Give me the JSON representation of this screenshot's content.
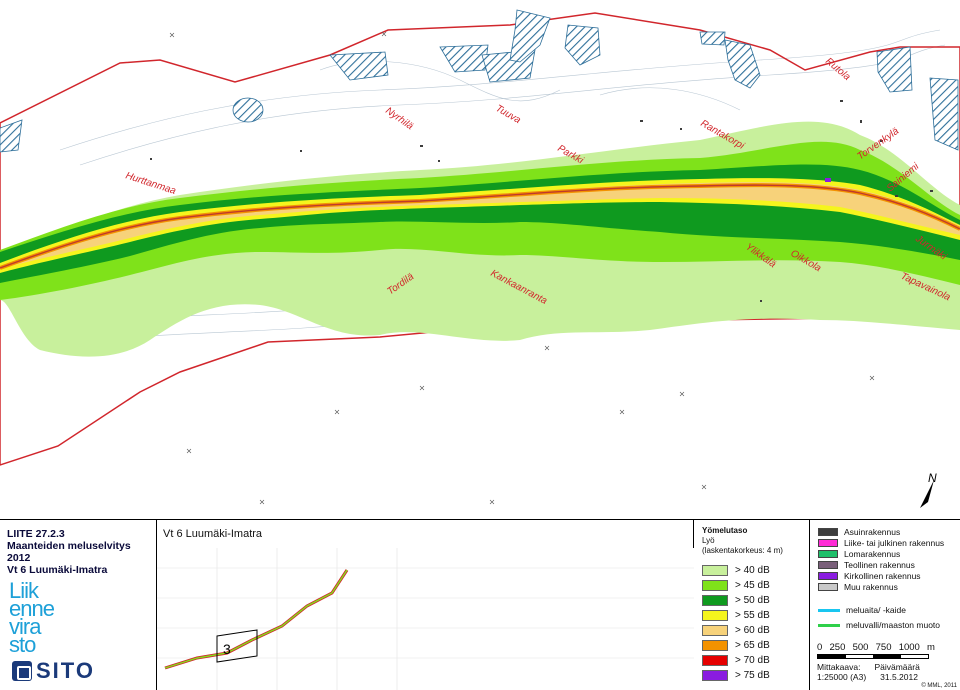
{
  "map": {
    "places": [
      {
        "name": "Hurttanmaa"
      },
      {
        "name": "Nyrhilä"
      },
      {
        "name": "Tuuva"
      },
      {
        "name": "Parkki"
      },
      {
        "name": "Rantakorpi"
      },
      {
        "name": "Rutola"
      },
      {
        "name": "Torvenkylä"
      },
      {
        "name": "Sainiemi"
      },
      {
        "name": "Jurmäki"
      },
      {
        "name": "Tapavainola"
      },
      {
        "name": "Oikkola"
      },
      {
        "name": "Ylikkälä"
      },
      {
        "name": "Kankaanranta"
      },
      {
        "name": "Tordilä"
      }
    ],
    "north_label": "N"
  },
  "title_block": {
    "appendix": "LIITE 27.2.3",
    "line1": "Maanteiden meluselvitys 2012",
    "line2": "Vt 6 Luumäki-Imatra",
    "logo_words": [
      "Liik",
      "enne",
      "vira",
      "sto"
    ],
    "sito": "SITO"
  },
  "overview": {
    "title": "Vt 6 Luumäki-Imatra",
    "sheet_number": "3"
  },
  "noise_legend": {
    "heading": "Yömelutaso",
    "symbol": "Lyö",
    "note": "(laskentakorkeus: 4 m)",
    "levels": [
      {
        "label": "> 40 dB",
        "color": "#c8f09c"
      },
      {
        "label": "> 45 dB",
        "color": "#7fe21a"
      },
      {
        "label": "> 50 dB",
        "color": "#0f9a1f"
      },
      {
        "label": "> 55 dB",
        "color": "#f5f51d"
      },
      {
        "label": "> 60 dB",
        "color": "#f7d27a"
      },
      {
        "label": "> 65 dB",
        "color": "#f39200"
      },
      {
        "label": "> 70 dB",
        "color": "#e50000"
      },
      {
        "label": "> 75 dB",
        "color": "#8a1ce0"
      }
    ]
  },
  "building_legend": {
    "items": [
      {
        "label": "Asuinrakennus",
        "color": "#3d3d3d"
      },
      {
        "label": "Liike- tai julkinen rakennus",
        "color": "#ff2bd6"
      },
      {
        "label": "Lomarakennus",
        "color": "#1fbf6a"
      },
      {
        "label": "Teollinen rakennus",
        "color": "#7a5f7a"
      },
      {
        "label": "Kirkollinen rakennus",
        "color": "#8a1ce0"
      },
      {
        "label": "Muu rakennus",
        "color": "#c9c9c9"
      }
    ],
    "lines": [
      {
        "label": "meluaita/ -kaide",
        "color": "#19c6f0"
      },
      {
        "label": "meluvalli/maaston muoto",
        "color": "#2fd04a"
      }
    ],
    "scale_ticks": [
      "0",
      "250",
      "500",
      "750",
      "1000"
    ],
    "scale_unit": "m",
    "scale_label": "Mittakaava:",
    "scale_value": "1:25000 (A3)",
    "date_label": "Päivämäärä",
    "date_value": "31.5.2012",
    "copyright": "© MML, 2011"
  }
}
